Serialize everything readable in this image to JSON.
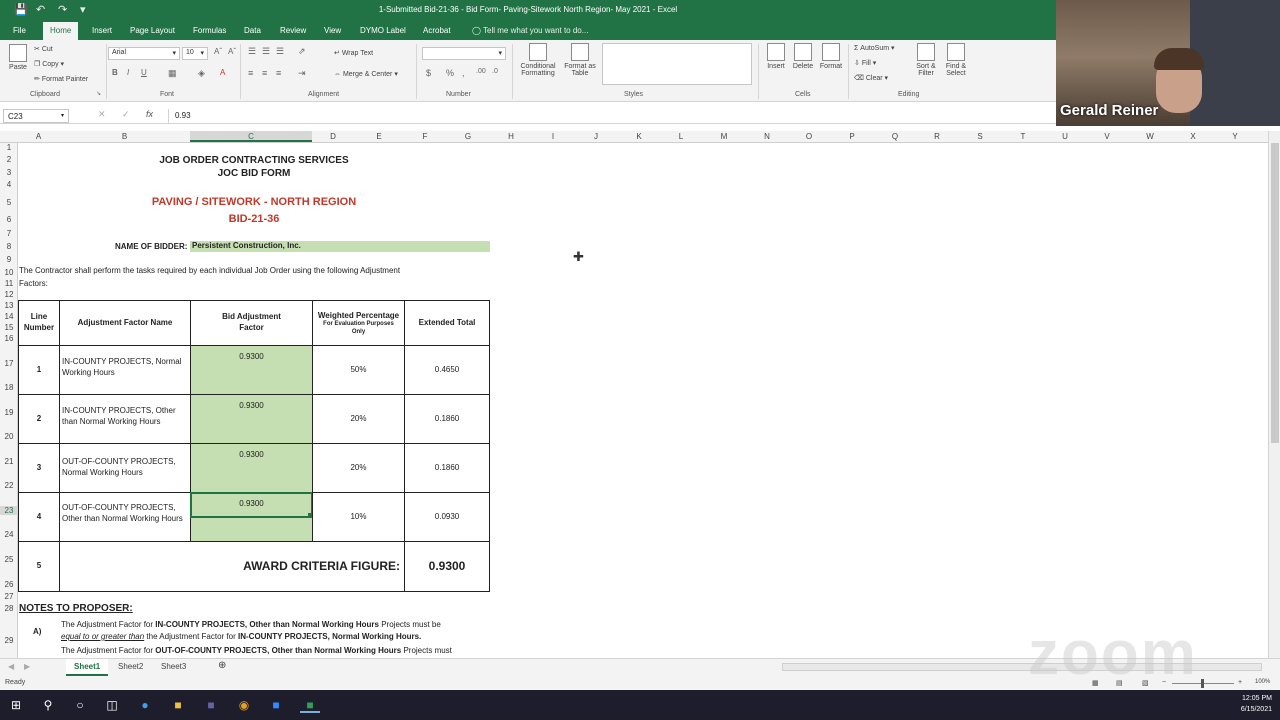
{
  "window": {
    "title": "1-Submitted Bid-21-36 - Bid Form- Paving-Sitework North Region- May 2021 - Excel"
  },
  "tabs": [
    "File",
    "Home",
    "Insert",
    "Page Layout",
    "Formulas",
    "Data",
    "Review",
    "View",
    "DYMO Label",
    "Acrobat"
  ],
  "tell_me": "Tell me what you want to do...",
  "ribbon": {
    "clipboard": {
      "paste": "Paste",
      "cut": "Cut",
      "copy": "Copy",
      "format_painter": "Format Painter",
      "label": "Clipboard"
    },
    "font": {
      "name": "Arial",
      "size": "10",
      "label": "Font"
    },
    "alignment": {
      "wrap_text": "Wrap Text",
      "merge_center": "Merge & Center",
      "label": "Alignment"
    },
    "number": {
      "label": "Number"
    },
    "styles": {
      "conditional": "Conditional Formatting",
      "format_as_table": "Format as Table",
      "label": "Styles"
    },
    "cells": {
      "insert": "Insert",
      "delete": "Delete",
      "format": "Format",
      "label": "Cells"
    },
    "editing": {
      "autosum": "AutoSum",
      "fill": "Fill",
      "clear": "Clear",
      "sort_filter": "Sort & Filter",
      "find_select": "Find & Select",
      "label": "Editing"
    }
  },
  "formula_bar": {
    "name_box": "C23",
    "fx": "fx",
    "value": "0.93"
  },
  "columns": [
    "A",
    "B",
    "C",
    "D",
    "E",
    "F",
    "G",
    "H",
    "I",
    "J",
    "K",
    "L",
    "M",
    "N",
    "O",
    "P",
    "Q",
    "R",
    "S",
    "T",
    "U",
    "V",
    "W",
    "X",
    "Y"
  ],
  "rows": [
    "1",
    "2",
    "3",
    "4",
    "5",
    "6",
    "7",
    "8",
    "9",
    "10",
    "11",
    "12",
    "13",
    "14",
    "15",
    "16",
    "17",
    "18",
    "19",
    "20",
    "21",
    "22",
    "23",
    "24",
    "25",
    "26",
    "27",
    "28",
    "29"
  ],
  "form": {
    "title1": "JOB ORDER CONTRACTING SERVICES",
    "title2": "JOC BID FORM",
    "subtitle1": "PAVING / SITEWORK - NORTH REGION",
    "subtitle2": "BID-21-36",
    "bidder_label": "NAME OF BIDDER:",
    "bidder_value": "Persistent Construction, Inc.",
    "instructions_1": "The Contractor shall perform the tasks required by each individual Job Order using the following Adjustment",
    "instructions_2": "Factors:",
    "headers": {
      "line": "Line Number",
      "name": "Adjustment Factor Name",
      "bid": "Bid Adjustment Factor",
      "weight": "Weighted Percentage",
      "weight_sub": "For Evaluation Purposes Only",
      "total": "Extended Total"
    },
    "rows": [
      {
        "line": "1",
        "name": "IN-COUNTY PROJECTS, Normal Working Hours",
        "factor": "0.9300",
        "weight": "50%",
        "total": "0.4650"
      },
      {
        "line": "2",
        "name": "IN-COUNTY PROJECTS, Other than Normal Working Hours",
        "factor": "0.9300",
        "weight": "20%",
        "total": "0.1860"
      },
      {
        "line": "3",
        "name": "OUT-OF-COUNTY PROJECTS, Normal Working Hours",
        "factor": "0.9300",
        "weight": "20%",
        "total": "0.1860"
      },
      {
        "line": "4",
        "name": "OUT-OF-COUNTY PROJECTS, Other than Normal Working Hours",
        "factor": "0.9300",
        "weight": "10%",
        "total": "0.0930"
      }
    ],
    "award_line": "5",
    "award_label": "AWARD CRITERIA FIGURE:",
    "award_value": "0.9300",
    "notes_title": "NOTES TO PROPOSER:",
    "note_a_label": "A)",
    "note_a_1a": "The Adjustment Factor for ",
    "note_a_1b": "IN-COUNTY PROJECTS, Other than Normal Working Hours",
    "note_a_1c": " Projects must be",
    "note_a_2a": "equal to or greater than",
    "note_a_2b": " the Adjustment Factor for ",
    "note_a_2c": "IN-COUNTY PROJECTS, Normal Working Hours.",
    "note_b_1a": "The Adjustment Factor for ",
    "note_b_1b": "OUT-OF-COUNTY PROJECTS, Other than Normal Working Hours",
    "note_b_1c": " Projects must"
  },
  "sheets": [
    "Sheet1",
    "Sheet2",
    "Sheet3"
  ],
  "status": {
    "ready": "Ready",
    "zoom": "100%"
  },
  "video": {
    "name": "Gerald Reiner"
  },
  "watermark": "zoom",
  "clock": {
    "time": "12:05 PM",
    "date": "6/15/2021"
  },
  "colors": {
    "excel_green": "#217346",
    "cell_green": "#c6dfb2",
    "title_red": "#c0392b"
  }
}
